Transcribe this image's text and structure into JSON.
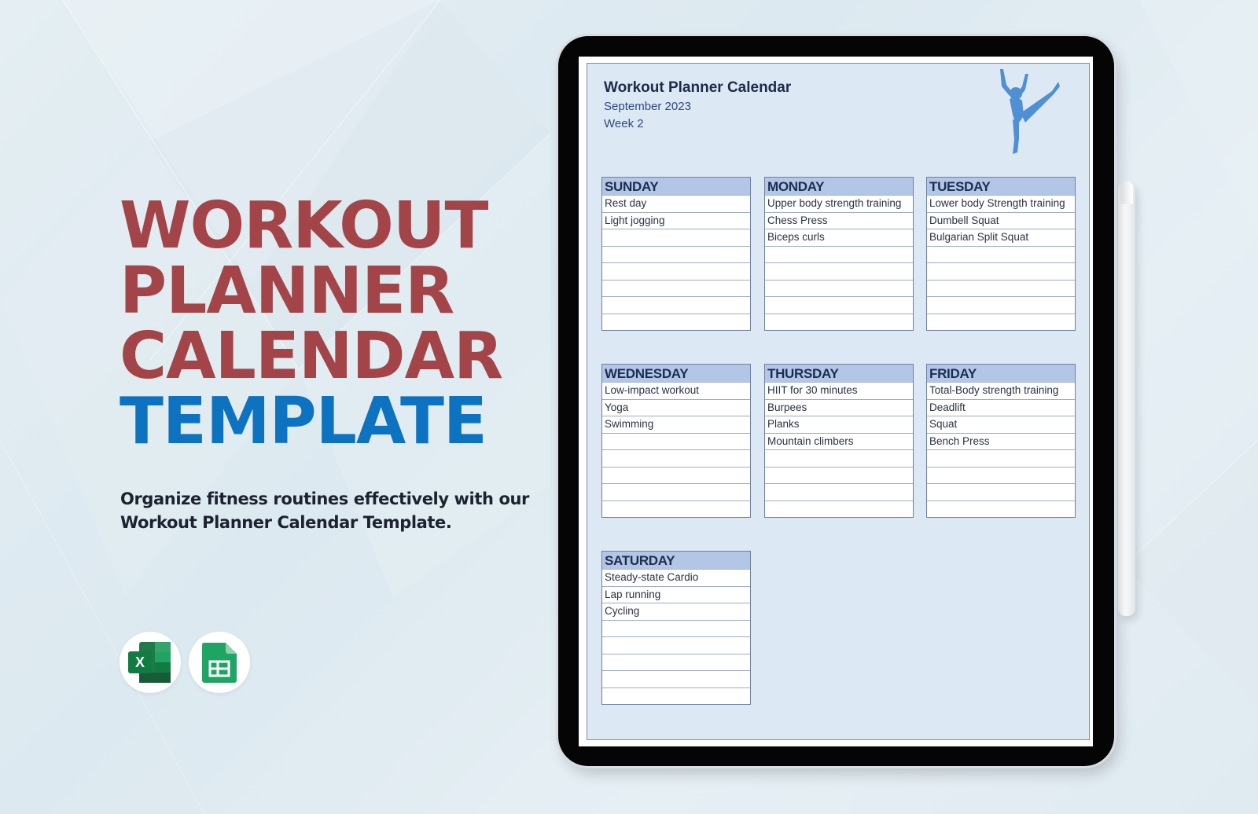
{
  "promo": {
    "title_lines": [
      "WORKOUT",
      "PLANNER",
      "CALENDAR"
    ],
    "title_highlight": "TEMPLATE",
    "description_line1": "Organize fitness routines effectively with our",
    "description_line2": "Workout Planner Calendar Template.",
    "colors": {
      "title_red": "#a24448",
      "title_blue": "#0d72c0"
    },
    "app_icons": [
      {
        "name": "excel-icon",
        "label": "X"
      },
      {
        "name": "google-sheets-icon"
      }
    ]
  },
  "document": {
    "title": "Workout Planner Calendar",
    "month": "September 2023",
    "week": "Week 2",
    "header_color": "#b3c6e6",
    "days": [
      {
        "name": "SUNDAY",
        "items": [
          "Rest day",
          "Light jogging",
          "",
          "",
          "",
          "",
          "",
          ""
        ]
      },
      {
        "name": "MONDAY",
        "items": [
          "Upper body strength training",
          "Chess Press",
          "Biceps curls",
          "",
          "",
          "",
          "",
          ""
        ]
      },
      {
        "name": "TUESDAY",
        "items": [
          "Lower body Strength training",
          "Dumbell Squat",
          "Bulgarian Split Squat",
          "",
          "",
          "",
          "",
          ""
        ]
      },
      {
        "name": "WEDNESDAY",
        "items": [
          "Low-impact workout",
          "Yoga",
          "Swimming",
          "",
          "",
          "",
          "",
          ""
        ]
      },
      {
        "name": "THURSDAY",
        "items": [
          "HIIT for 30 minutes",
          "Burpees",
          "Planks",
          "Mountain climbers",
          "",
          "",
          "",
          ""
        ]
      },
      {
        "name": "FRIDAY",
        "items": [
          "Total-Body strength training",
          "Deadlift",
          "Squat",
          "Bench Press",
          "",
          "",
          "",
          ""
        ]
      },
      {
        "name": "SATURDAY",
        "items": [
          "Steady-state Cardio",
          "Lap running",
          "Cycling",
          "",
          "",
          "",
          "",
          ""
        ]
      }
    ]
  }
}
